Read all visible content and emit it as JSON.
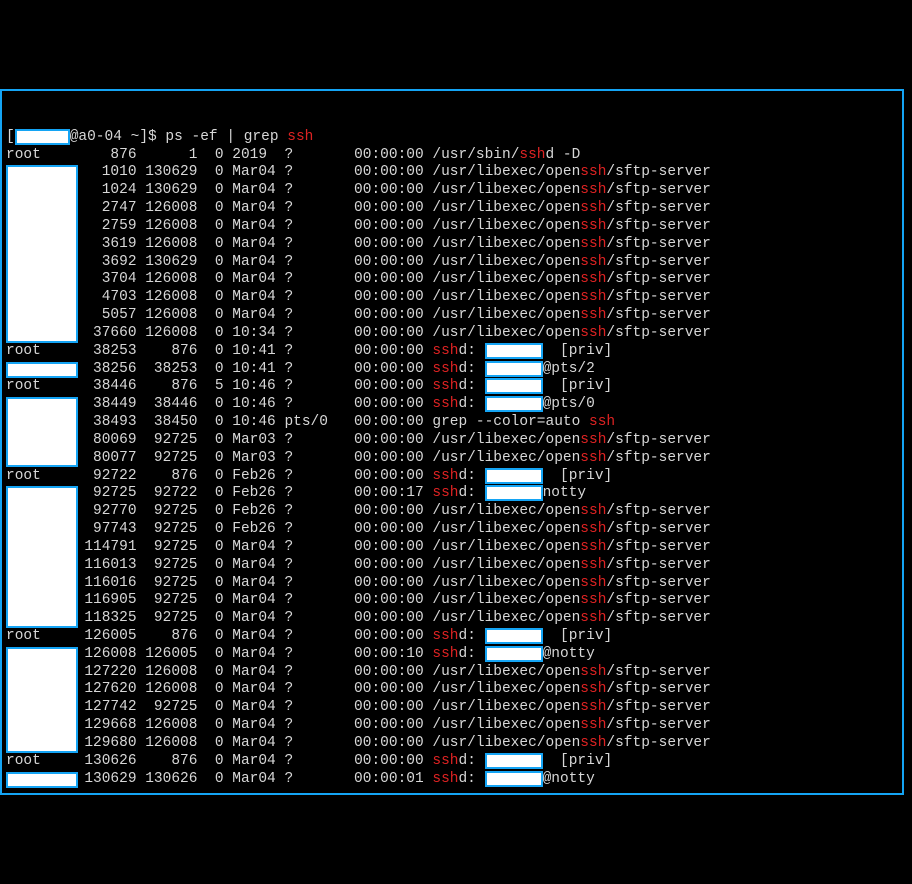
{
  "prompt": {
    "prefix": "[",
    "host": "@a0-04 ~]$ ",
    "cmd_plain_1": "ps -ef | grep ",
    "cmd_hl_1": "ssh"
  },
  "cols": {
    "uid_pad": "       ",
    "root": "root",
    "pid_pad": "   "
  },
  "paths": {
    "sbin_pre": "/usr/sbin/",
    "sbin_post": "d -D",
    "lib_pre": "/usr/libexec/open",
    "lib_post": "/sftp-server",
    "sshd_pre": "",
    "sshd_colon": "d:",
    "sshd_priv": " [priv]",
    "sshd_pts2": "@pts/2",
    "sshd_pts0": "@pts/0",
    "sshd_notty": "@notty",
    "grep_pre": "grep --color=auto ",
    "grep_hl": "ssh"
  },
  "rows": [
    {
      "uid": "root",
      "pid": "   876",
      "ppid": "     1",
      "c": "0",
      "stime": "2019 ",
      "tty": "?    ",
      "time": "00:00:00",
      "cmd": "sbin"
    },
    {
      "uid": "RED-small",
      "pid": "  1010",
      "ppid": "130629",
      "c": "0",
      "stime": "Mar04",
      "tty": "?    ",
      "time": "00:00:00",
      "cmd": "sftp"
    },
    {
      "uid": "RED-cont",
      "pid": "  1024",
      "ppid": "130629",
      "c": "0",
      "stime": "Mar04",
      "tty": "?    ",
      "time": "00:00:00",
      "cmd": "sftp"
    },
    {
      "uid": "RED-cont",
      "pid": "  2747",
      "ppid": "126008",
      "c": "0",
      "stime": "Mar04",
      "tty": "?    ",
      "time": "00:00:00",
      "cmd": "sftp"
    },
    {
      "uid": "RED-cont",
      "pid": "  2759",
      "ppid": "126008",
      "c": "0",
      "stime": "Mar04",
      "tty": "?    ",
      "time": "00:00:00",
      "cmd": "sftp"
    },
    {
      "uid": "RED-cont",
      "pid": "  3619",
      "ppid": "126008",
      "c": "0",
      "stime": "Mar04",
      "tty": "?    ",
      "time": "00:00:00",
      "cmd": "sftp"
    },
    {
      "uid": "RED-cont",
      "pid": "  3692",
      "ppid": "130629",
      "c": "0",
      "stime": "Mar04",
      "tty": "?    ",
      "time": "00:00:00",
      "cmd": "sftp"
    },
    {
      "uid": "RED-cont",
      "pid": "  3704",
      "ppid": "126008",
      "c": "0",
      "stime": "Mar04",
      "tty": "?    ",
      "time": "00:00:00",
      "cmd": "sftp"
    },
    {
      "uid": "RED-cont",
      "pid": "  4703",
      "ppid": "126008",
      "c": "0",
      "stime": "Mar04",
      "tty": "?    ",
      "time": "00:00:00",
      "cmd": "sftp"
    },
    {
      "uid": "RED-cont",
      "pid": "  5057",
      "ppid": "126008",
      "c": "0",
      "stime": "Mar04",
      "tty": "?    ",
      "time": "00:00:00",
      "cmd": "sftp"
    },
    {
      "uid": "RED-cont",
      "pid": " 37660",
      "ppid": "126008",
      "c": "0",
      "stime": "10:34",
      "tty": "?    ",
      "time": "00:00:00",
      "cmd": "sftp"
    },
    {
      "uid": "root",
      "pid": " 38253",
      "ppid": "   876",
      "c": "0",
      "stime": "10:41",
      "tty": "?    ",
      "time": "00:00:00",
      "cmd": "sshd_priv"
    },
    {
      "uid": "RED-small",
      "pid": " 38256",
      "ppid": " 38253",
      "c": "0",
      "stime": "10:41",
      "tty": "?    ",
      "time": "00:00:00",
      "cmd": "sshd_pts2"
    },
    {
      "uid": "root",
      "pid": " 38446",
      "ppid": "   876",
      "c": "5",
      "stime": "10:46",
      "tty": "?    ",
      "time": "00:00:00",
      "cmd": "sshd_priv"
    },
    {
      "uid": "RED-small",
      "pid": " 38449",
      "ppid": " 38446",
      "c": "0",
      "stime": "10:46",
      "tty": "?    ",
      "time": "00:00:00",
      "cmd": "sshd_pts0"
    },
    {
      "uid": "RED-cont",
      "pid": " 38493",
      "ppid": " 38450",
      "c": "0",
      "stime": "10:46",
      "tty": "pts/0",
      "time": "00:00:00",
      "cmd": "grep"
    },
    {
      "uid": "RED-cont",
      "pid": " 80069",
      "ppid": " 92725",
      "c": "0",
      "stime": "Mar03",
      "tty": "?    ",
      "time": "00:00:00",
      "cmd": "sftp"
    },
    {
      "uid": "RED-cont",
      "pid": " 80077",
      "ppid": " 92725",
      "c": "0",
      "stime": "Mar03",
      "tty": "?    ",
      "time": "00:00:00",
      "cmd": "sftp"
    },
    {
      "uid": "root",
      "pid": " 92722",
      "ppid": "   876",
      "c": "0",
      "stime": "Feb26",
      "tty": "?    ",
      "time": "00:00:00",
      "cmd": "sshd_priv"
    },
    {
      "uid": "RED-small",
      "pid": " 92725",
      "ppid": " 92722",
      "c": "0",
      "stime": "Feb26",
      "tty": "?    ",
      "time": "00:00:17",
      "cmd": "sshd_notty_trim"
    },
    {
      "uid": "RED-cont",
      "pid": " 92770",
      "ppid": " 92725",
      "c": "0",
      "stime": "Feb26",
      "tty": "?    ",
      "time": "00:00:00",
      "cmd": "sftp"
    },
    {
      "uid": "RED-cont",
      "pid": " 97743",
      "ppid": " 92725",
      "c": "0",
      "stime": "Feb26",
      "tty": "?    ",
      "time": "00:00:00",
      "cmd": "sftp"
    },
    {
      "uid": "RED-cont",
      "pid": "114791",
      "ppid": " 92725",
      "c": "0",
      "stime": "Mar04",
      "tty": "?    ",
      "time": "00:00:00",
      "cmd": "sftp"
    },
    {
      "uid": "RED-cont",
      "pid": "116013",
      "ppid": " 92725",
      "c": "0",
      "stime": "Mar04",
      "tty": "?    ",
      "time": "00:00:00",
      "cmd": "sftp"
    },
    {
      "uid": "RED-cont",
      "pid": "116016",
      "ppid": " 92725",
      "c": "0",
      "stime": "Mar04",
      "tty": "?    ",
      "time": "00:00:00",
      "cmd": "sftp"
    },
    {
      "uid": "RED-cont",
      "pid": "116905",
      "ppid": " 92725",
      "c": "0",
      "stime": "Mar04",
      "tty": "?    ",
      "time": "00:00:00",
      "cmd": "sftp"
    },
    {
      "uid": "RED-cont",
      "pid": "118325",
      "ppid": " 92725",
      "c": "0",
      "stime": "Mar04",
      "tty": "?    ",
      "time": "00:00:00",
      "cmd": "sftp"
    },
    {
      "uid": "root",
      "pid": "126005",
      "ppid": "   876",
      "c": "0",
      "stime": "Mar04",
      "tty": "?    ",
      "time": "00:00:00",
      "cmd": "sshd_priv"
    },
    {
      "uid": "RED-small",
      "pid": "126008",
      "ppid": "126005",
      "c": "0",
      "stime": "Mar04",
      "tty": "?    ",
      "time": "00:00:10",
      "cmd": "sshd_notty"
    },
    {
      "uid": "RED-cont",
      "pid": "127220",
      "ppid": "126008",
      "c": "0",
      "stime": "Mar04",
      "tty": "?    ",
      "time": "00:00:00",
      "cmd": "sftp"
    },
    {
      "uid": "RED-cont",
      "pid": "127620",
      "ppid": "126008",
      "c": "0",
      "stime": "Mar04",
      "tty": "?    ",
      "time": "00:00:00",
      "cmd": "sftp"
    },
    {
      "uid": "RED-cont",
      "pid": "127742",
      "ppid": " 92725",
      "c": "0",
      "stime": "Mar04",
      "tty": "?    ",
      "time": "00:00:00",
      "cmd": "sftp"
    },
    {
      "uid": "RED-cont",
      "pid": "129668",
      "ppid": "126008",
      "c": "0",
      "stime": "Mar04",
      "tty": "?    ",
      "time": "00:00:00",
      "cmd": "sftp"
    },
    {
      "uid": "RED-cont",
      "pid": "129680",
      "ppid": "126008",
      "c": "0",
      "stime": "Mar04",
      "tty": "?    ",
      "time": "00:00:00",
      "cmd": "sftp"
    },
    {
      "uid": "root",
      "pid": "130626",
      "ppid": "   876",
      "c": "0",
      "stime": "Mar04",
      "tty": "?    ",
      "time": "00:00:00",
      "cmd": "sshd_priv"
    },
    {
      "uid": "RED-small",
      "pid": "130629",
      "ppid": "130626",
      "c": "0",
      "stime": "Mar04",
      "tty": "?    ",
      "time": "00:00:01",
      "cmd": "sshd_notty"
    }
  ],
  "hl": "ssh"
}
